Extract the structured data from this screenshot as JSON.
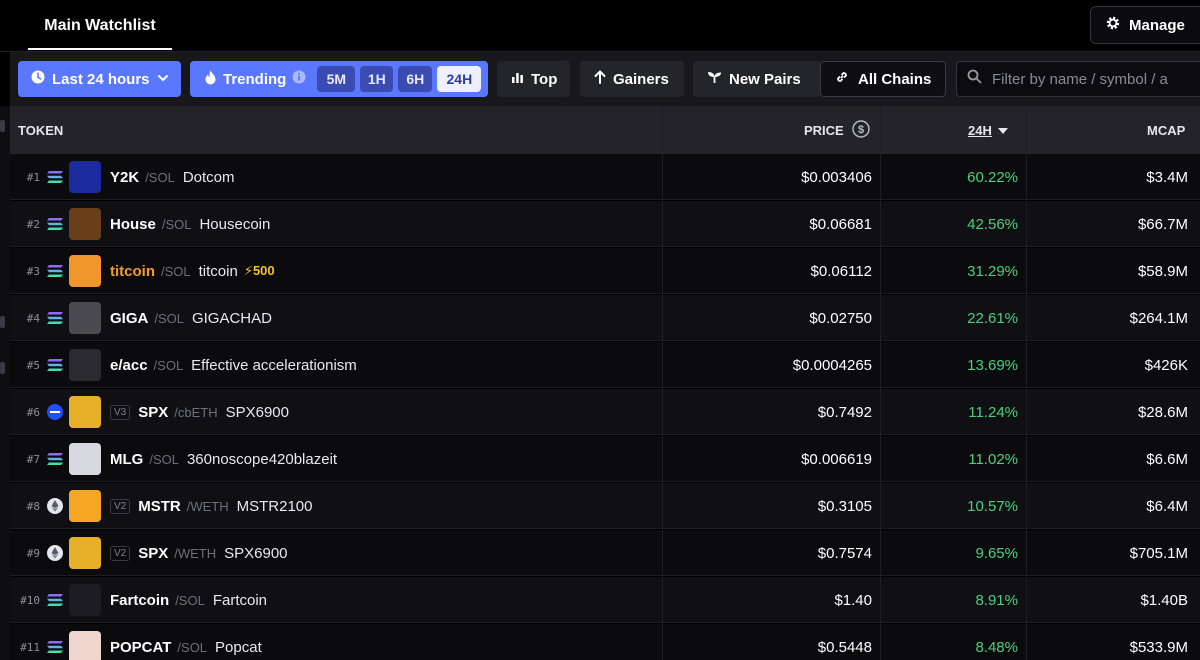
{
  "header": {
    "tab_label": "Main Watchlist",
    "manage_label": "Manage"
  },
  "filters": {
    "time_label": "Last 24 hours",
    "trending_label": "Trending",
    "trending_pills": [
      "5M",
      "1H",
      "6H",
      "24H"
    ],
    "active_pill": "24H",
    "top_label": "Top",
    "gainers_label": "Gainers",
    "new_pairs_label": "New Pairs",
    "all_chains_label": "All Chains",
    "filter_placeholder": "Filter by name / symbol / a"
  },
  "columns": {
    "token": "TOKEN",
    "price": "PRICE",
    "change": "24H",
    "mcap": "MCAP"
  },
  "colors": {
    "accent_blue": "#5a78ff",
    "positive_green": "#4cd07d"
  },
  "rows": [
    {
      "rank": "#1",
      "chain": "solana",
      "version": "",
      "symbol": "Y2K",
      "quote": "/SOL",
      "name": "Dotcom",
      "boost": "",
      "price": "$0.003406",
      "change": "60.22%",
      "mcap": "$3.4M"
    },
    {
      "rank": "#2",
      "chain": "solana",
      "version": "",
      "symbol": "House",
      "quote": "/SOL",
      "name": "Housecoin",
      "boost": "",
      "price": "$0.06681",
      "change": "42.56%",
      "mcap": "$66.7M"
    },
    {
      "rank": "#3",
      "chain": "solana",
      "version": "",
      "symbol": "titcoin",
      "quote": "/SOL",
      "name": "titcoin",
      "boost": "⚡500",
      "price": "$0.06112",
      "change": "31.29%",
      "mcap": "$58.9M"
    },
    {
      "rank": "#4",
      "chain": "solana",
      "version": "",
      "symbol": "GIGA",
      "quote": "/SOL",
      "name": "GIGACHAD",
      "boost": "",
      "price": "$0.02750",
      "change": "22.61%",
      "mcap": "$264.1M"
    },
    {
      "rank": "#5",
      "chain": "solana",
      "version": "",
      "symbol": "e/acc",
      "quote": "/SOL",
      "name": "Effective accelerationism",
      "boost": "",
      "price": "$0.0004265",
      "change": "13.69%",
      "mcap": "$426K"
    },
    {
      "rank": "#6",
      "chain": "base",
      "version": "V3",
      "symbol": "SPX",
      "quote": "/cbETH",
      "name": "SPX6900",
      "boost": "",
      "price": "$0.7492",
      "change": "11.24%",
      "mcap": "$28.6M"
    },
    {
      "rank": "#7",
      "chain": "solana",
      "version": "",
      "symbol": "MLG",
      "quote": "/SOL",
      "name": "360noscope420blazeit",
      "boost": "",
      "price": "$0.006619",
      "change": "11.02%",
      "mcap": "$6.6M"
    },
    {
      "rank": "#8",
      "chain": "ethereum",
      "version": "V2",
      "symbol": "MSTR",
      "quote": "/WETH",
      "name": "MSTR2100",
      "boost": "",
      "price": "$0.3105",
      "change": "10.57%",
      "mcap": "$6.4M"
    },
    {
      "rank": "#9",
      "chain": "ethereum",
      "version": "V2",
      "symbol": "SPX",
      "quote": "/WETH",
      "name": "SPX6900",
      "boost": "",
      "price": "$0.7574",
      "change": "9.65%",
      "mcap": "$705.1M"
    },
    {
      "rank": "#10",
      "chain": "solana",
      "version": "",
      "symbol": "Fartcoin",
      "quote": "/SOL",
      "name": "Fartcoin",
      "boost": "",
      "price": "$1.40",
      "change": "8.91%",
      "mcap": "$1.40B"
    },
    {
      "rank": "#11",
      "chain": "solana",
      "version": "",
      "symbol": "POPCAT",
      "quote": "/SOL",
      "name": "Popcat",
      "boost": "",
      "price": "$0.5448",
      "change": "8.48%",
      "mcap": "$533.9M"
    }
  ]
}
